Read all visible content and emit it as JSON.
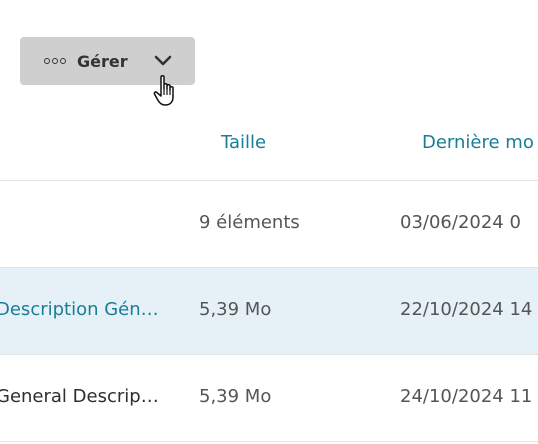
{
  "toolbar": {
    "manage_label": "Gérer"
  },
  "table": {
    "headers": {
      "size": "Taille",
      "modified": "Dernière mo"
    },
    "rows": [
      {
        "name": "",
        "size": "9 éléments",
        "modified": "03/06/2024 0"
      },
      {
        "name": "Description Gén…",
        "size": "5,39 Mo",
        "modified": "22/10/2024 14"
      },
      {
        "name": "General Descript…",
        "size": "5,39 Mo",
        "modified": "24/10/2024 11"
      }
    ]
  },
  "colors": {
    "accent": "#1a7d96",
    "selected_row": "#e5f1f7",
    "button_bg": "#cfcfcf"
  }
}
